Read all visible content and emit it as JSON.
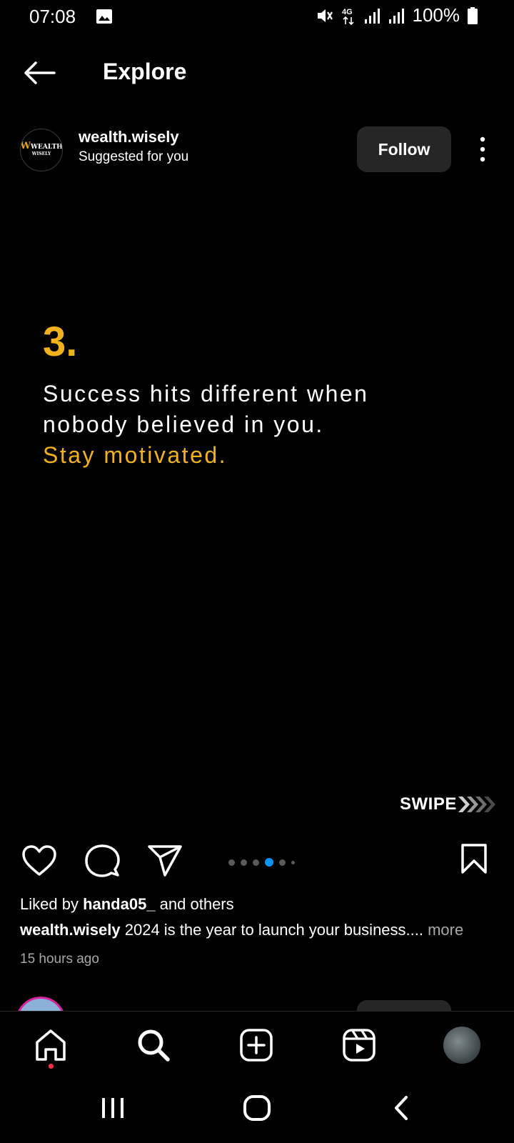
{
  "status_bar": {
    "time": "07:08",
    "network": "4G",
    "battery": "100%",
    "icons": [
      "gallery-icon",
      "mute-icon",
      "4g-icon",
      "signal-icon",
      "signal-icon",
      "battery-icon"
    ]
  },
  "header": {
    "title": "Explore",
    "back_icon": "arrow-left-icon"
  },
  "post": {
    "username": "wealth.wisely",
    "subtitle": "Suggested for you",
    "follow_label": "Follow",
    "avatar_logo_line1": "WEALTH",
    "avatar_logo_line2": "WISELY",
    "slide_number": "3.",
    "quote_line1": "Success hits different when",
    "quote_line2": "nobody believed in you.",
    "quote_accent": "Stay motivated.",
    "swipe_label": "SWIPE",
    "carousel_total": 6,
    "carousel_active": 4,
    "liked_by_prefix": "Liked by ",
    "liked_by_user": "handa05_",
    "liked_by_suffix": " and others",
    "caption_user": "wealth.wisely",
    "caption_text": " 2024 is the year to launch your business.... ",
    "caption_more": "more",
    "timestamp": "15 hours ago"
  },
  "colors": {
    "accent_gold": "#f2b21d",
    "background": "#000000",
    "button_bg": "#262626",
    "active_dot": "#0095f6",
    "notification_dot": "#ff3040"
  },
  "bottom_nav": {
    "items": [
      "home-icon",
      "search-icon",
      "create-icon",
      "reels-icon",
      "profile-avatar"
    ]
  },
  "system_nav": {
    "items": [
      "recents-icon",
      "home-circle-icon",
      "back-chevron-icon"
    ]
  }
}
